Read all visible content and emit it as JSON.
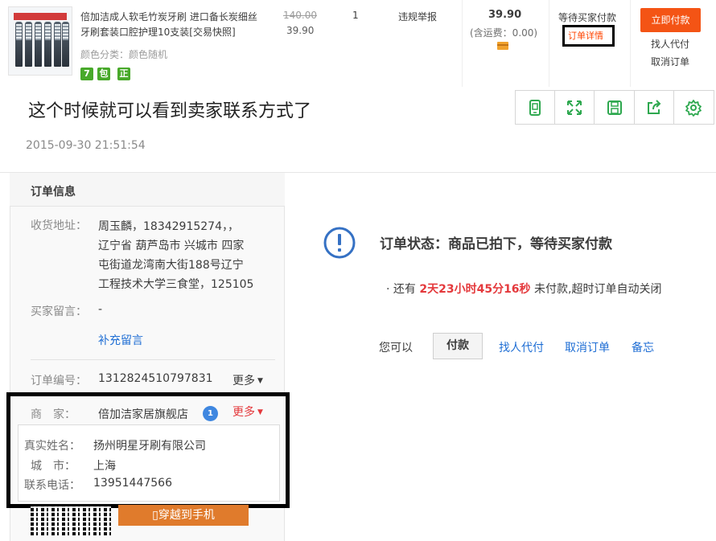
{
  "order": {
    "item_title_line1": "倍加洁成人软毛竹炭牙刷 进口备长炭细丝",
    "item_title_line2": "牙刷套装口腔护理10支装[交易快照]",
    "sku": "颜色分类：颜色随机",
    "badges": [
      {
        "text": "7",
        "color": "#48a92a"
      },
      {
        "text": "包",
        "color": "#48a92a"
      },
      {
        "text": "正",
        "color": "#48a92a"
      }
    ],
    "price_original": "140.00",
    "price_current": "39.90",
    "quantity": "1",
    "report_label": "违规举报",
    "total": "39.90",
    "shipping": "(含运费：0.00)",
    "status": "等待买家付款",
    "detail_link": "订单详情",
    "pay_now": "立即付款",
    "find_payer": "找人代付",
    "cancel": "取消订单"
  },
  "caption": "这个时候就可以看到卖家联系方式了",
  "toolbar": {
    "icons": [
      "phone-icon",
      "fullscreen-icon",
      "save-icon",
      "share-icon",
      "settings-icon"
    ],
    "accent": "#2ea84f"
  },
  "timestamp": "2015-09-30 21:51:54",
  "info": {
    "title": "订单信息",
    "address_label": "收货地址：",
    "address_line1": "周玉麟，18342915274，，",
    "address_line2": "辽宁省 葫芦岛市 兴城市 四家",
    "address_line3": "屯街道龙湾南大街188号辽宁",
    "address_line4": "工程技术大学三食堂，125105",
    "message_label": "买家留言：",
    "message_value": "-",
    "add_message": "补充留言",
    "order_no_label": "订单编号：",
    "order_no": "1312824510797831",
    "more": "更多",
    "seller_label": "商　家：",
    "seller_name": "倍加洁家居旗舰店",
    "seller_more": "更多",
    "popup": {
      "name_label": "真实姓名：",
      "name_value": "扬州明星牙刷有限公司",
      "city_label": "城　市：",
      "city_value": "上海",
      "phone_label": "联系电话：",
      "phone_value": "13951447566"
    },
    "mobile_button": "穿越到手机"
  },
  "status": {
    "title": "订单状态：商品已拍下，等待买家付款",
    "countdown_prefix": "· 还有 ",
    "countdown_time": "2天23小时45分16秒",
    "countdown_suffix": " 未付款,超时订单自动关闭",
    "you_can": "您可以",
    "pay": "付款",
    "find_payer": "找人代付",
    "cancel": "取消订单",
    "memo": "备忘",
    "icon_color": "#3571c4",
    "link_color": "#1f6ed4",
    "accent_red": "#e4393c"
  }
}
